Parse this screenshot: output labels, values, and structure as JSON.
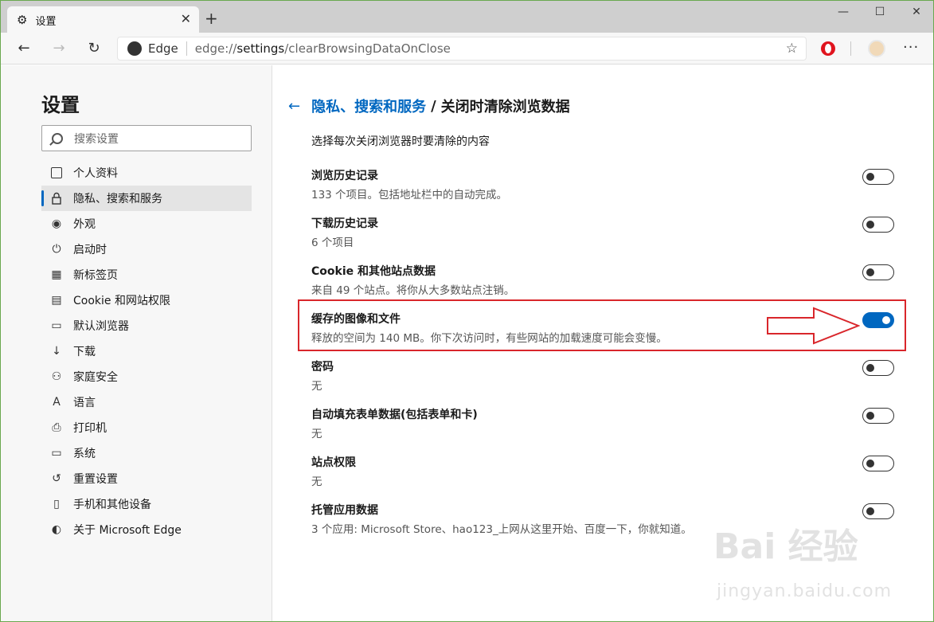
{
  "tab": {
    "title": "设置",
    "close": "✕",
    "new_tab": "+"
  },
  "window_controls": {
    "minimize": "—",
    "maximize": "☐",
    "close": "✕"
  },
  "toolbar": {
    "back": "←",
    "forward": "→",
    "refresh": "↻",
    "site_brand": "Edge",
    "url_prefix": "edge://",
    "url_main": "settings",
    "url_path": "/clearBrowsingDataOnClose",
    "favorite_icon": "☆",
    "more": "···"
  },
  "sidebar": {
    "title": "设置",
    "search_placeholder": "搜索设置",
    "items": [
      {
        "label": "个人资料",
        "icon": "profile-icon",
        "glyph": ""
      },
      {
        "label": "隐私、搜索和服务",
        "icon": "lock-icon",
        "glyph": "🔒︎"
      },
      {
        "label": "外观",
        "icon": "palette-icon",
        "glyph": "◉"
      },
      {
        "label": "启动时",
        "icon": "power-icon",
        "glyph": "⏻"
      },
      {
        "label": "新标签页",
        "icon": "newtab-icon",
        "glyph": "▦"
      },
      {
        "label": "Cookie 和网站权限",
        "icon": "site-permissions-icon",
        "glyph": "▤"
      },
      {
        "label": "默认浏览器",
        "icon": "default-browser-icon",
        "glyph": "▭"
      },
      {
        "label": "下载",
        "icon": "download-icon",
        "glyph": "↓"
      },
      {
        "label": "家庭安全",
        "icon": "family-icon",
        "glyph": "⚇"
      },
      {
        "label": "语言",
        "icon": "language-icon",
        "glyph": "A"
      },
      {
        "label": "打印机",
        "icon": "printer-icon",
        "glyph": "⎙"
      },
      {
        "label": "系统",
        "icon": "system-icon",
        "glyph": "▭"
      },
      {
        "label": "重置设置",
        "icon": "reset-icon",
        "glyph": "↺"
      },
      {
        "label": "手机和其他设备",
        "icon": "phone-icon",
        "glyph": "▯"
      },
      {
        "label": "关于 Microsoft Edge",
        "icon": "edge-icon",
        "glyph": "◐"
      }
    ]
  },
  "main": {
    "back_arrow": "←",
    "breadcrumb_parent": "隐私、搜索和服务",
    "breadcrumb_sep": "/",
    "breadcrumb_current": "关闭时清除浏览数据",
    "description": "选择每次关闭浏览器时要清除的内容",
    "rows": [
      {
        "title": "浏览历史记录",
        "subtitle": "133 个项目。包括地址栏中的自动完成。",
        "on": false
      },
      {
        "title": "下载历史记录",
        "subtitle": "6 个项目",
        "on": false
      },
      {
        "title": "Cookie 和其他站点数据",
        "subtitle": "来自 49 个站点。将你从大多数站点注销。",
        "on": false
      },
      {
        "title": "缓存的图像和文件",
        "subtitle": "释放的空间为 140 MB。你下次访问时，有些网站的加载速度可能会变慢。",
        "on": true
      },
      {
        "title": "密码",
        "subtitle": "无",
        "on": false
      },
      {
        "title": "自动填充表单数据(包括表单和卡)",
        "subtitle": "无",
        "on": false
      },
      {
        "title": "站点权限",
        "subtitle": "无",
        "on": false
      },
      {
        "title": "托管应用数据",
        "subtitle": "3 个应用: Microsoft Store、hao123_上网从这里开始、百度一下，你就知道。",
        "on": false
      }
    ]
  },
  "watermark": {
    "main": "Bai 经验",
    "sub": "jingyan.baidu.com"
  },
  "colors": {
    "accent": "#0067c0",
    "annotation_red": "#d9262b"
  }
}
